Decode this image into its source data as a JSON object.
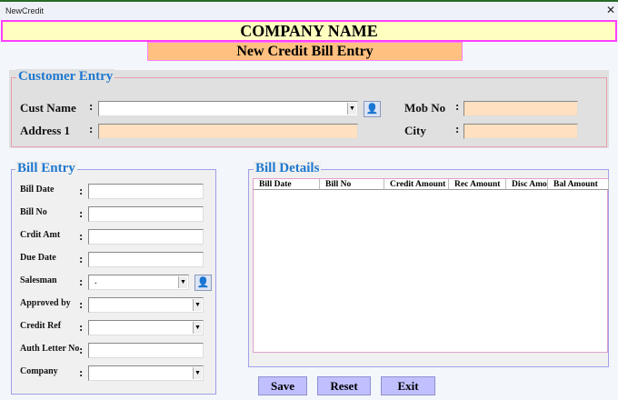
{
  "window": {
    "title": "NewCredit",
    "close_icon": "close-icon"
  },
  "header": {
    "company": "COMPANY NAME",
    "subtitle": "New Credit Bill Entry"
  },
  "customer": {
    "legend": "Customer Entry",
    "cust_name_label": "Cust Name",
    "cust_name_value": "",
    "address_label": "Address 1",
    "mob_label": "Mob No",
    "city_label": "City",
    "colon": ":"
  },
  "bill_entry": {
    "legend": "Bill Entry",
    "fields": [
      {
        "label": "Bill Date",
        "type": "text",
        "value": ""
      },
      {
        "label": "Bill No",
        "type": "text",
        "value": ""
      },
      {
        "label": "Crdit Amt",
        "type": "text",
        "value": ""
      },
      {
        "label": "Due Date",
        "type": "text",
        "value": ""
      },
      {
        "label": "Salesman",
        "type": "combo",
        "value": "."
      },
      {
        "label": "Approved by",
        "type": "combo",
        "value": ""
      },
      {
        "label": "Credit Ref",
        "type": "combo",
        "value": ""
      },
      {
        "label": "Auth Letter No",
        "type": "text",
        "value": ""
      },
      {
        "label": "Company",
        "type": "combo",
        "value": ""
      }
    ]
  },
  "bill_details": {
    "legend": "Bill Details",
    "columns": [
      "Bill Date",
      "Bill No",
      "Credit Amount",
      "Rec Amount",
      "Disc Amo",
      "Bal Amount"
    ]
  },
  "buttons": {
    "save": "Save",
    "reset": "Reset",
    "exit": "Exit"
  }
}
